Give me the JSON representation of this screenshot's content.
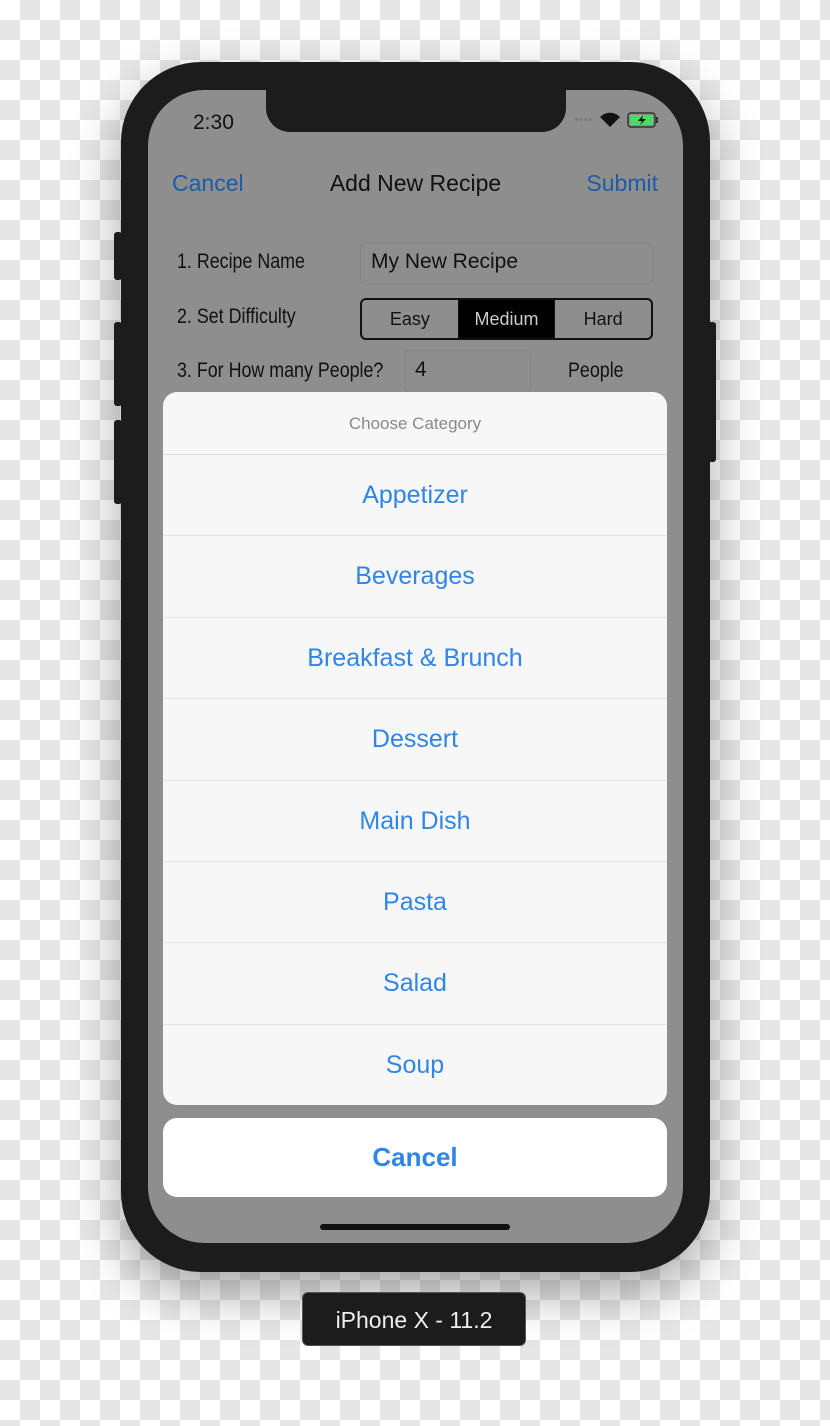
{
  "status": {
    "time": "2:30",
    "battery_color": "#4cd964"
  },
  "nav": {
    "cancel": "Cancel",
    "title": "Add New Recipe",
    "submit": "Submit"
  },
  "form": {
    "name_label": "1. Recipe Name",
    "name_value": "My New Recipe",
    "difficulty_label": "2. Set Difficulty",
    "difficulty_options": [
      "Easy",
      "Medium",
      "Hard"
    ],
    "difficulty_selected": "Medium",
    "people_label": "3. For How many People?",
    "people_value": "4",
    "people_unit": "People"
  },
  "action_sheet": {
    "title": "Choose Category",
    "items": [
      "Appetizer",
      "Beverages",
      "Breakfast & Brunch",
      "Dessert",
      "Main Dish",
      "Pasta",
      "Salad",
      "Soup"
    ],
    "cancel": "Cancel",
    "accent": "#2f86e6"
  },
  "device_label": "iPhone X - 11.2"
}
